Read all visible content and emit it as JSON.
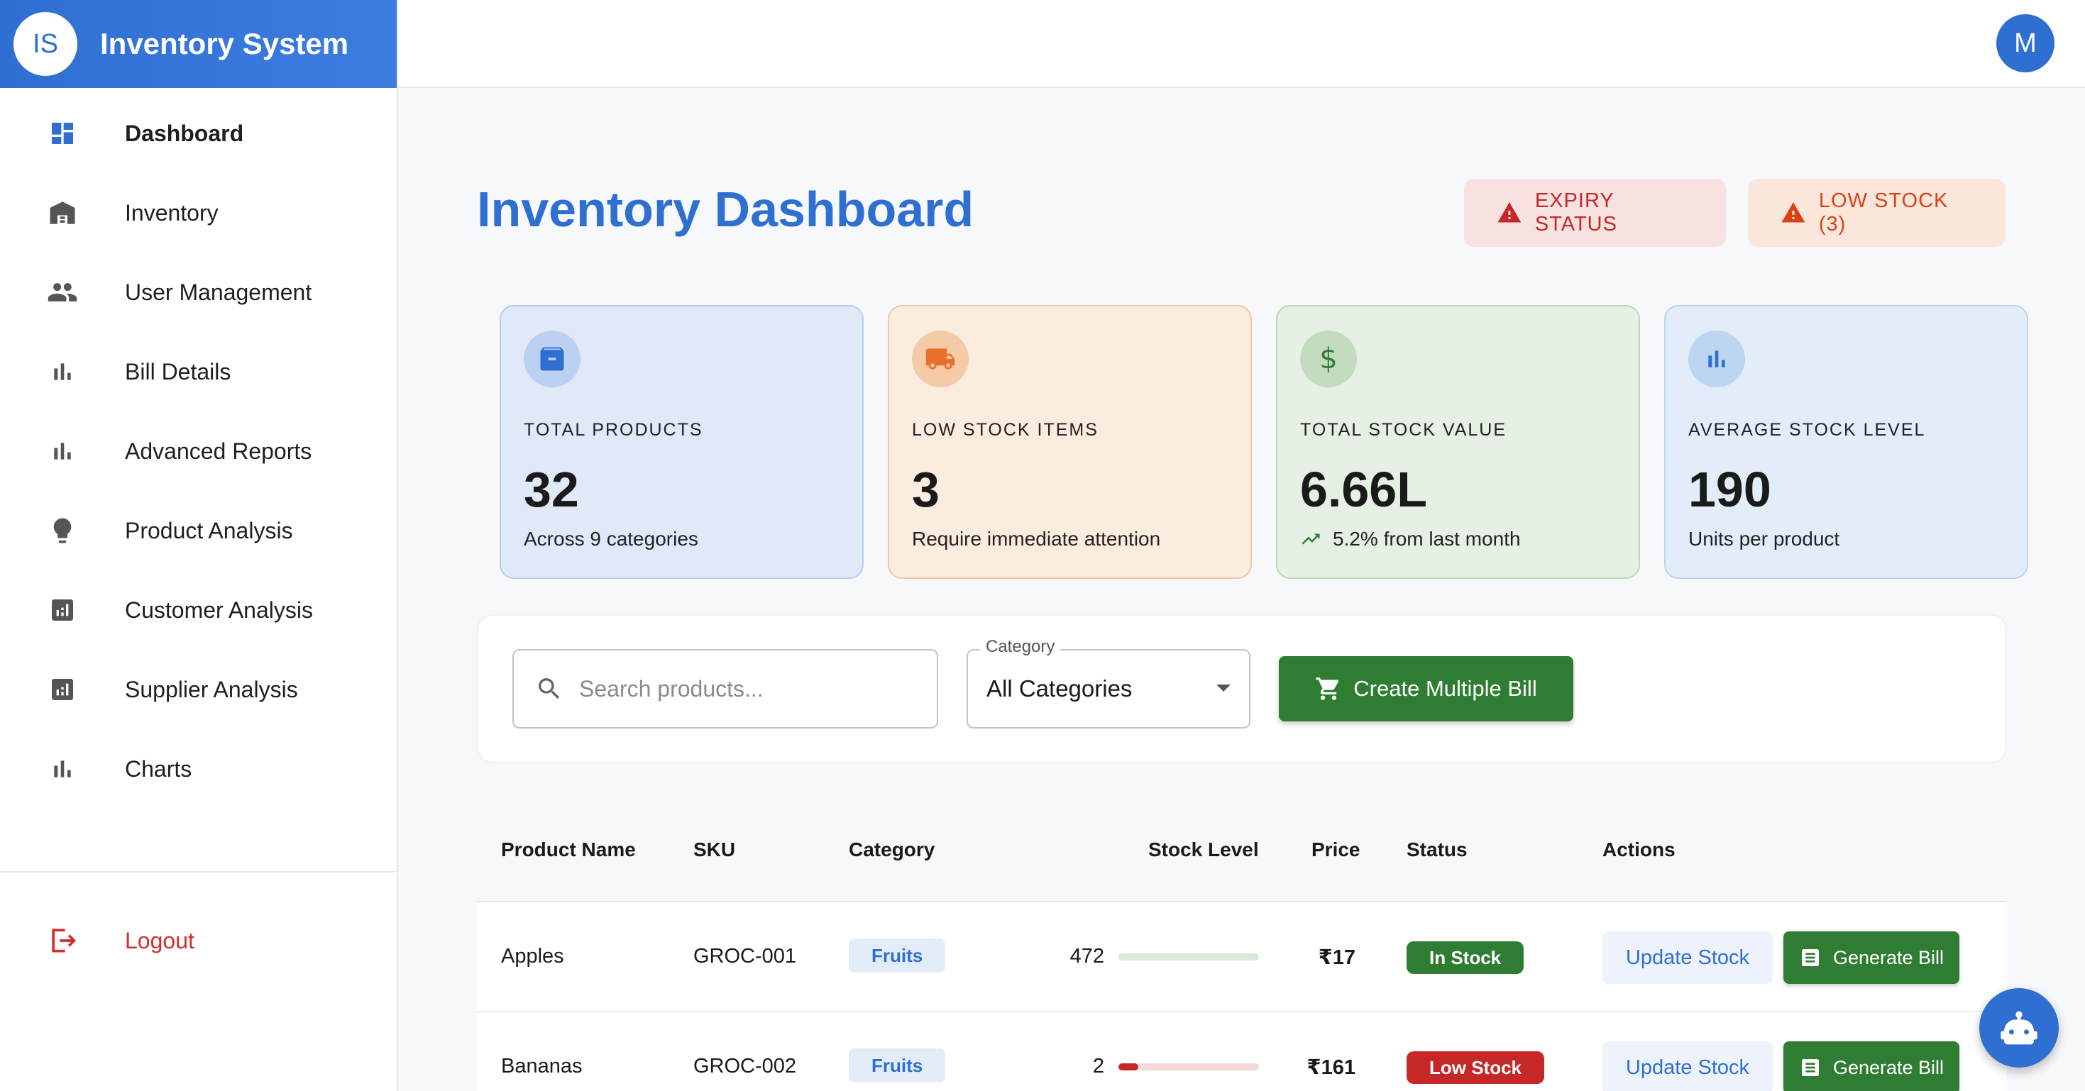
{
  "brand": {
    "logo_text": "IS",
    "title": "Inventory System"
  },
  "user": {
    "avatar_letter": "M"
  },
  "sidebar": {
    "items": [
      {
        "label": "Dashboard",
        "icon": "dashboard-icon",
        "active": true
      },
      {
        "label": "Inventory",
        "icon": "warehouse-icon"
      },
      {
        "label": "User Management",
        "icon": "people-icon"
      },
      {
        "label": "Bill Details",
        "icon": "bar-chart-icon"
      },
      {
        "label": "Advanced Reports",
        "icon": "bar-chart-icon"
      },
      {
        "label": "Product Analysis",
        "icon": "lightbulb-icon"
      },
      {
        "label": "Customer Analysis",
        "icon": "analytics-icon"
      },
      {
        "label": "Supplier Analysis",
        "icon": "analytics-icon"
      },
      {
        "label": "Charts",
        "icon": "bar-chart-icon"
      }
    ],
    "logout": "Logout"
  },
  "main": {
    "title": "Inventory Dashboard",
    "alerts": {
      "expiry": "EXPIRY STATUS",
      "low_stock": "LOW STOCK (3)"
    }
  },
  "stats": [
    {
      "title": "TOTAL PRODUCTS",
      "value": "32",
      "sub": "Across 9 categories",
      "icon": "archive-icon"
    },
    {
      "title": "LOW STOCK ITEMS",
      "value": "3",
      "sub": "Require immediate attention",
      "icon": "truck-icon"
    },
    {
      "title": "TOTAL STOCK VALUE",
      "value": "6.66L",
      "sub": "5.2% from last month",
      "icon": "dollar-icon"
    },
    {
      "title": "AVERAGE STOCK LEVEL",
      "value": "190",
      "sub": "Units per product",
      "icon": "bar-chart-icon"
    }
  ],
  "filters": {
    "search_placeholder": "Search products...",
    "category_label": "Category",
    "category_value": "All Categories",
    "create_button": "Create Multiple Bill"
  },
  "table": {
    "headers": [
      "Product Name",
      "SKU",
      "Category",
      "Stock Level",
      "Price",
      "Status",
      "Actions"
    ],
    "rows": [
      {
        "name": "Apples",
        "sku": "GROC-001",
        "category": "Fruits",
        "stock": "472",
        "stock_fraction": 1.0,
        "price": "₹17",
        "status": "In Stock",
        "status_color": "#2e7d32",
        "update": "Update Stock",
        "generate": "Generate Bill"
      },
      {
        "name": "Bananas",
        "sku": "GROC-002",
        "category": "Fruits",
        "stock": "2",
        "stock_fraction": 0.14,
        "price": "₹161",
        "status": "Low Stock",
        "status_color": "#c62828",
        "update": "Update Stock",
        "generate": "Generate Bill"
      }
    ]
  },
  "colors": {
    "primary": "#2f6fd1",
    "success": "#2e7d32",
    "danger": "#c62828",
    "warning": "#d84315"
  }
}
